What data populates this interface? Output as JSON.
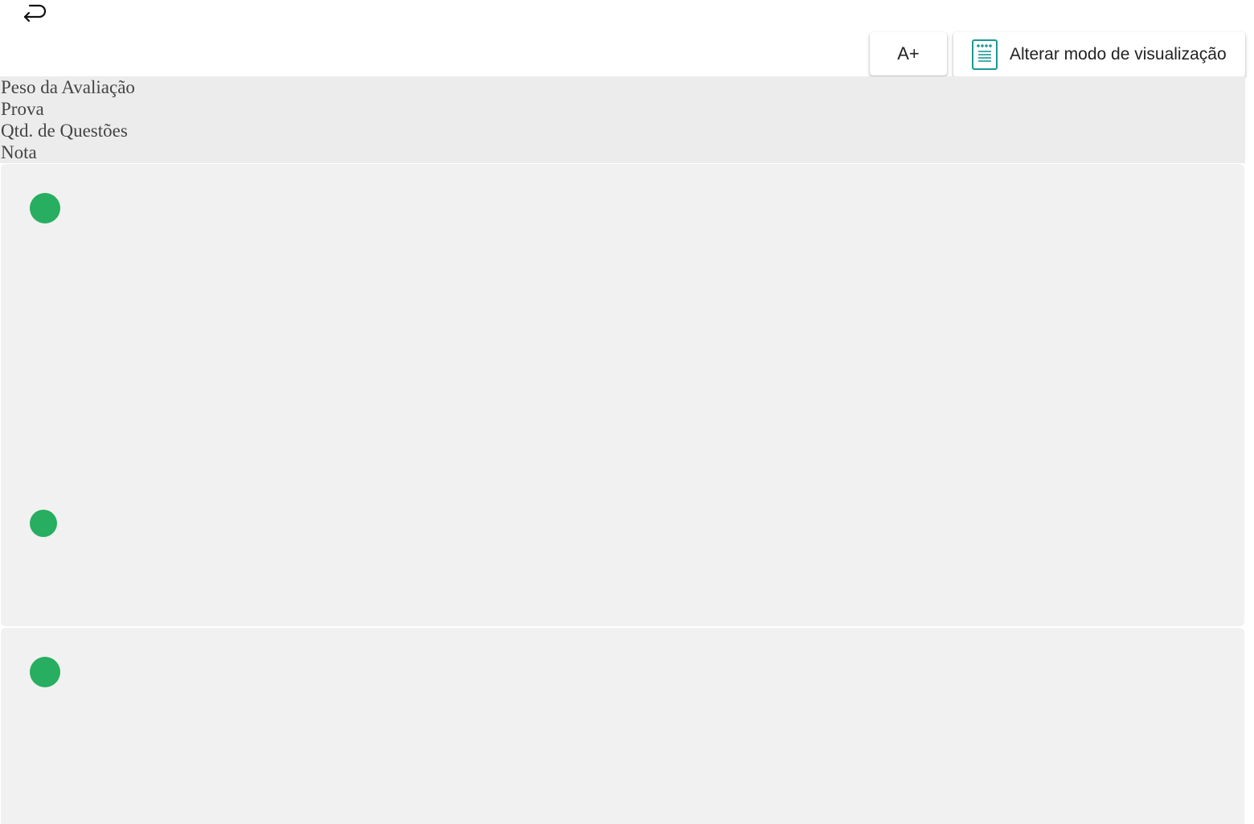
{
  "toolbar": {
    "font_button_label": "A+",
    "view_button_label": "Alterar modo de visualização",
    "accent_color": "#1a9a93"
  },
  "header": {
    "fields": [
      "Peso da Avaliação",
      "Prova",
      "Qtd. de Questões",
      "Nota"
    ]
  },
  "status_color": "#27ae60"
}
